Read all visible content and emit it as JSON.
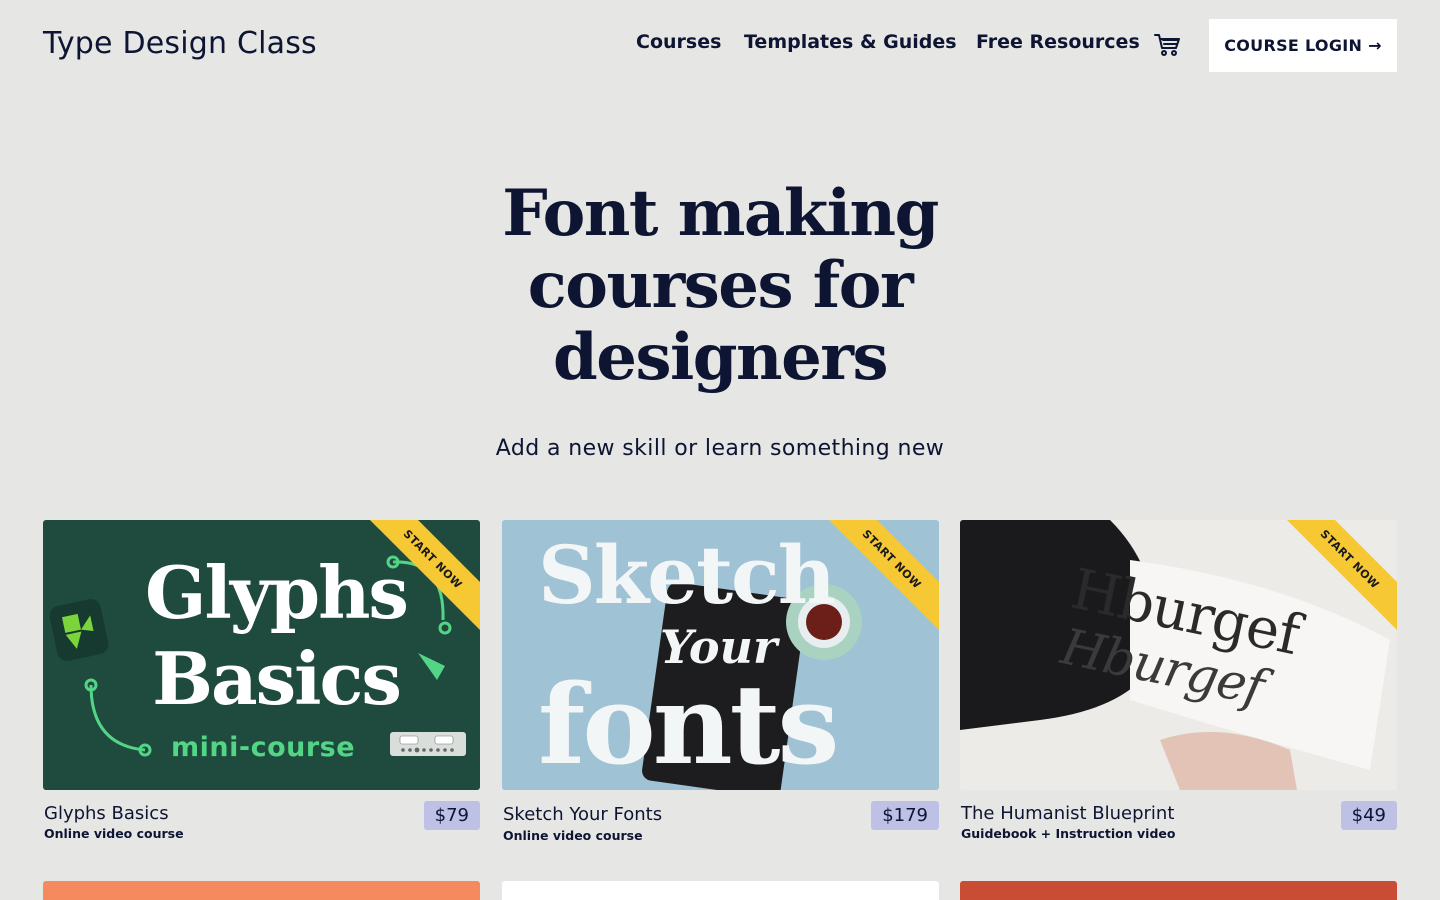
{
  "header": {
    "logo": "Type Design Class",
    "nav": [
      {
        "label": "Courses"
      },
      {
        "label": "Templates & Guides"
      },
      {
        "label": "Free Resources"
      }
    ],
    "cart_icon": "cart-icon",
    "login_label": "COURSE LOGIN →"
  },
  "hero": {
    "title_lines": [
      "Font making",
      "courses for",
      "designers"
    ],
    "subtitle": "Add a new skill or learn something new"
  },
  "cards": [
    {
      "title": "Glyphs Basics",
      "subtitle": "Online video course",
      "price": "$79",
      "ribbon": "START NOW",
      "art": {
        "line1": "Glyphs",
        "line2": "Basics",
        "tag": "mini-course"
      }
    },
    {
      "title": "Sketch Your Fonts",
      "subtitle": "Online video course",
      "price": "$179",
      "ribbon": "START NOW",
      "art": {
        "line1": "Sketch",
        "line2": "Your",
        "line3": "fonts"
      }
    },
    {
      "title": "The Humanist Blueprint",
      "subtitle": "Guidebook + Instruction video",
      "price": "$49",
      "ribbon": "START NOW",
      "art": {
        "line1": "Hburgef",
        "line2": "Hburgef"
      }
    }
  ],
  "colors": {
    "background": "#e6e6e4",
    "text": "#0d1533",
    "price_badge": "#bfc0e6",
    "ribbon": "#f6c834",
    "glyphs_bg": "#1f4a3e",
    "glyphs_accent": "#52d686"
  }
}
